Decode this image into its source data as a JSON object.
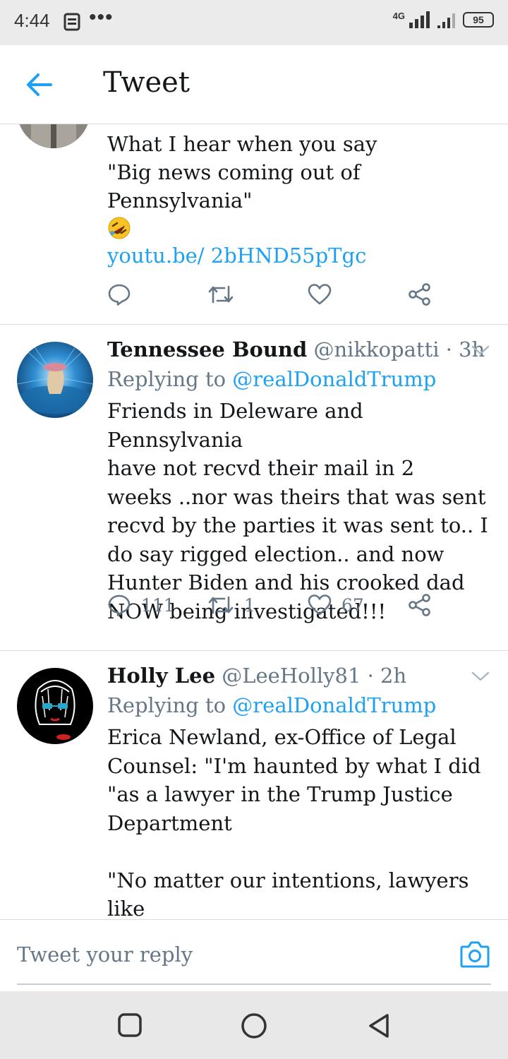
{
  "status_bar": {
    "time": "4:44",
    "network_label": "4G",
    "battery": "95"
  },
  "header": {
    "title": "Tweet"
  },
  "top_tweet": {
    "lines": [
      "What I hear when you say",
      "\"Big news coming out of",
      "Pennsylvania\""
    ],
    "emoji": "rolling-on-floor-laughing",
    "link": "youtu.be/ 2bHND55pTgc"
  },
  "replies": [
    {
      "name": "Tennessee Bound",
      "handle": "@nikkopatti",
      "time": "· 3h",
      "replying_label": "Replying to",
      "replying_to": "@realDonaldTrump",
      "text": "Friends in Deleware and Pennsylvania\nhave not recvd their mail in 2\nweeks ..nor was theirs that was sent\nrecvd by the parties it was sent to.. I\ndo say rigged election.. and now\nHunter Biden and his crooked dad\nNOW being investigated!!!",
      "reply_count": "111",
      "retweet_count": "1",
      "like_count": "67"
    },
    {
      "name": "Holly Lee",
      "handle": "@LeeHolly81",
      "time": "· 2h",
      "replying_label": "Replying to",
      "replying_to": "@realDonaldTrump",
      "text": "Erica Newland, ex-Office of Legal\nCounsel: \"I'm haunted by what I did\n\"as a lawyer in the Trump Justice\nDepartment\n\n\"No matter our intentions, lawyers like\nme were complicit. We owe the",
      "avatar_text": "Smile"
    }
  ],
  "composer": {
    "placeholder": "Tweet your reply"
  },
  "colors": {
    "accent": "#1da1f2",
    "secondary_text": "#657786",
    "divider": "#d8dde1"
  }
}
